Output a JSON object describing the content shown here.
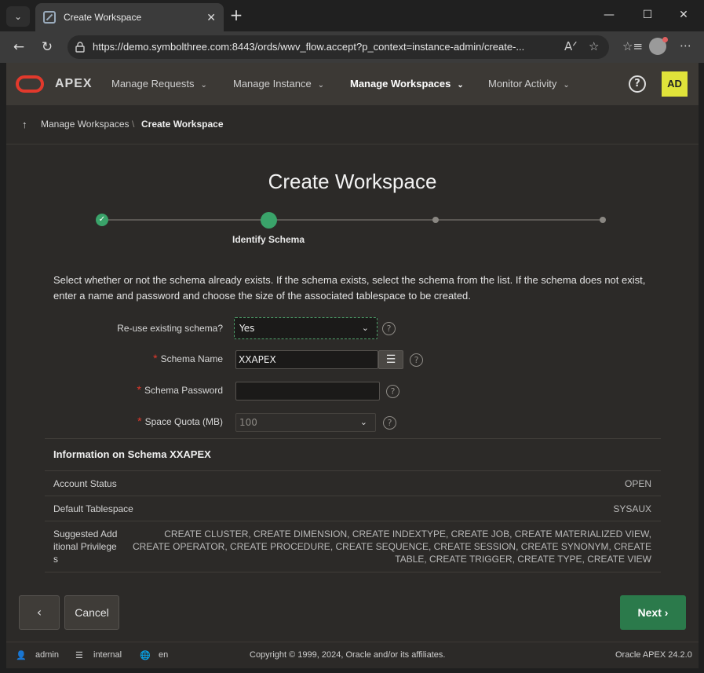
{
  "browser": {
    "tab_title": "Create Workspace",
    "url": "https://demo.symbolthree.com:8443/ords/wwv_flow.accept?p_context=instance-admin/create-..."
  },
  "header": {
    "logo": "APEX",
    "menus": [
      "Manage Requests",
      "Manage Instance",
      "Manage Workspaces",
      "Monitor Activity"
    ],
    "help": "?",
    "user_initials": "AD"
  },
  "breadcrumb": {
    "parent": "Manage Workspaces",
    "sep": "\\",
    "current": "Create Workspace"
  },
  "page": {
    "title": "Create Workspace",
    "step_label": "Identify Schema",
    "instructions": "Select whether or not the schema already exists. If the schema exists, select the schema from the list. If the schema does not exist, enter a name and password and choose the size of the associated tablespace to be created."
  },
  "form": {
    "reuse_label": "Re-use existing schema?",
    "reuse_value": "Yes",
    "schema_name_label": "Schema Name",
    "schema_name_value": "XXAPEX",
    "schema_password_label": "Schema Password",
    "schema_password_value": "",
    "quota_label": "Space Quota (MB)",
    "quota_value": "100",
    "required_mark": "*"
  },
  "info": {
    "title": "Information on Schema XXAPEX",
    "rows": [
      {
        "key": "Account Status",
        "value": "OPEN"
      },
      {
        "key": "Default Tablespace",
        "value": "SYSAUX"
      },
      {
        "key": "Suggested Additional Privileges",
        "value": "CREATE CLUSTER, CREATE DIMENSION, CREATE INDEXTYPE, CREATE JOB, CREATE MATERIALIZED VIEW, CREATE OPERATOR, CREATE PROCEDURE, CREATE SEQUENCE, CREATE SESSION, CREATE SYNONYM, CREATE TABLE, CREATE TRIGGER, CREATE TYPE, CREATE VIEW"
      }
    ]
  },
  "buttons": {
    "back": "‹",
    "cancel": "Cancel",
    "next": "Next"
  },
  "footer": {
    "user": "admin",
    "workspace": "internal",
    "language": "en",
    "copyright": "Copyright © 1999, 2024, Oracle and/or its affiliates.",
    "version": "Oracle APEX 24.2.0"
  },
  "colors": {
    "accent_green": "#2b7a4b",
    "oracle_red": "#e2392c",
    "avatar_yellow": "#e0e33a"
  }
}
